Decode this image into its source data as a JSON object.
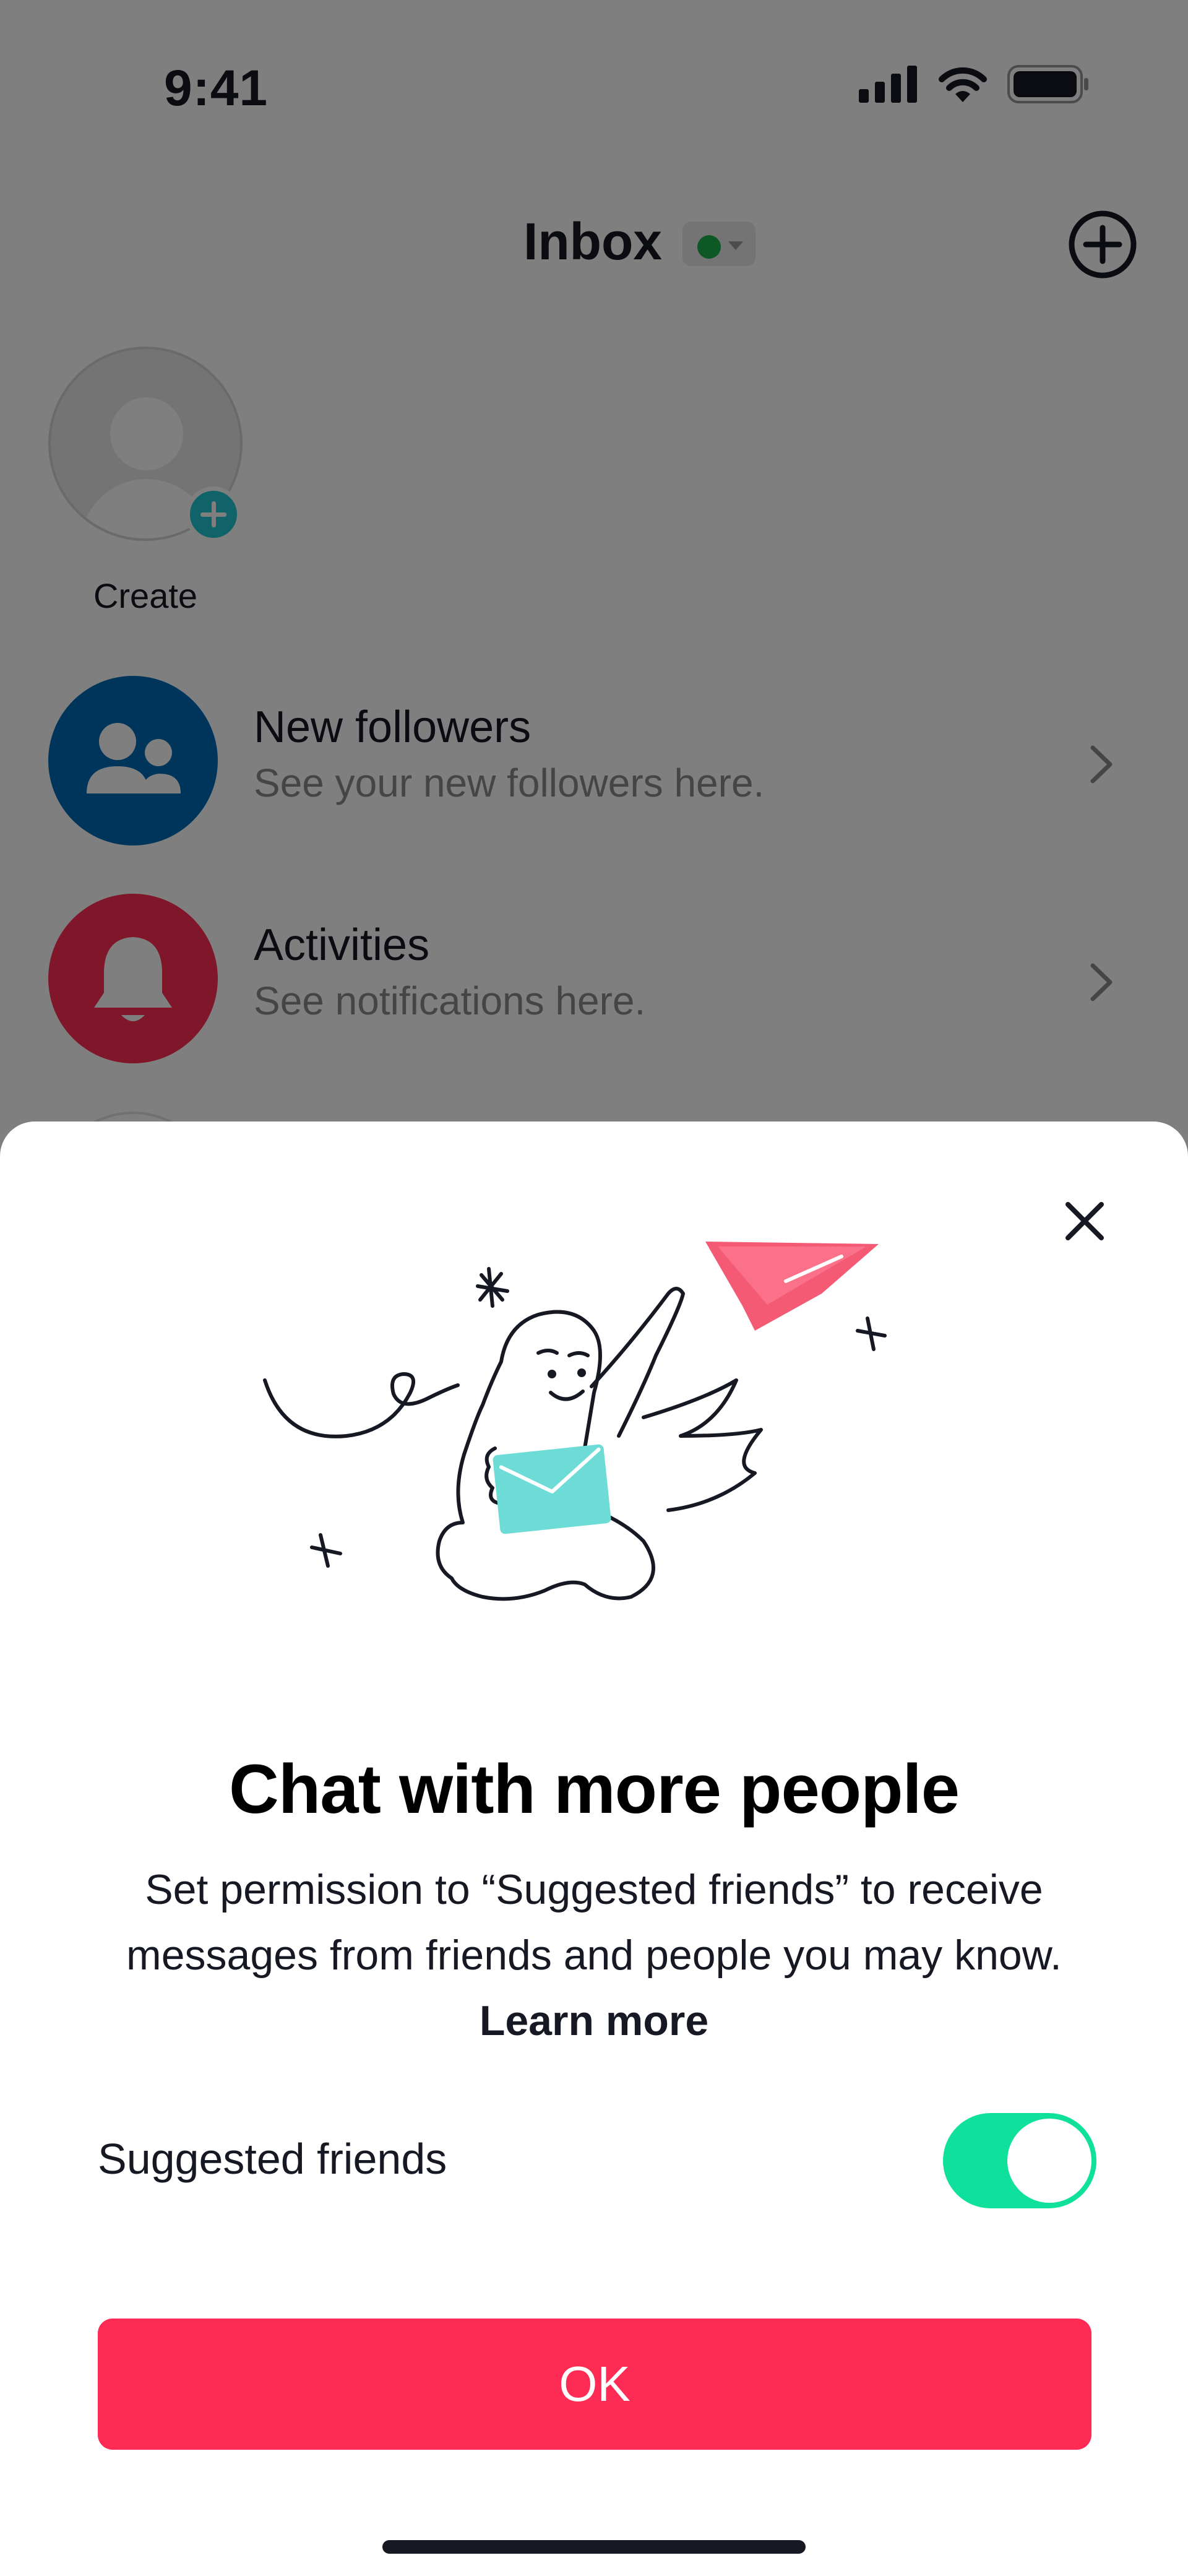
{
  "status_bar": {
    "time": "9:41",
    "icons": [
      "cellular-signal-icon",
      "wifi-icon",
      "battery-icon"
    ]
  },
  "header": {
    "title": "Inbox",
    "online_status_color": "#1bb04a",
    "add_icon": "plus-circle-icon"
  },
  "create": {
    "label": "Create",
    "plus_color": "#20c7d2"
  },
  "rows": [
    {
      "title": "New followers",
      "subtitle": "See your new followers here.",
      "icon": "people-icon",
      "color": "#006bb6"
    },
    {
      "title": "Activities",
      "subtitle": "See notifications here.",
      "icon": "bell-icon",
      "color": "#ff2c55"
    }
  ],
  "sheet": {
    "title": "Chat with more people",
    "description": "Set permission to “Suggested friends” to receive messages from friends and people you may know. ",
    "learn_more": "Learn more",
    "toggle_label": "Suggested friends",
    "toggle_on": true,
    "toggle_color": "#0fe09b",
    "ok_label": "OK",
    "ok_color": "#fe2c55"
  }
}
